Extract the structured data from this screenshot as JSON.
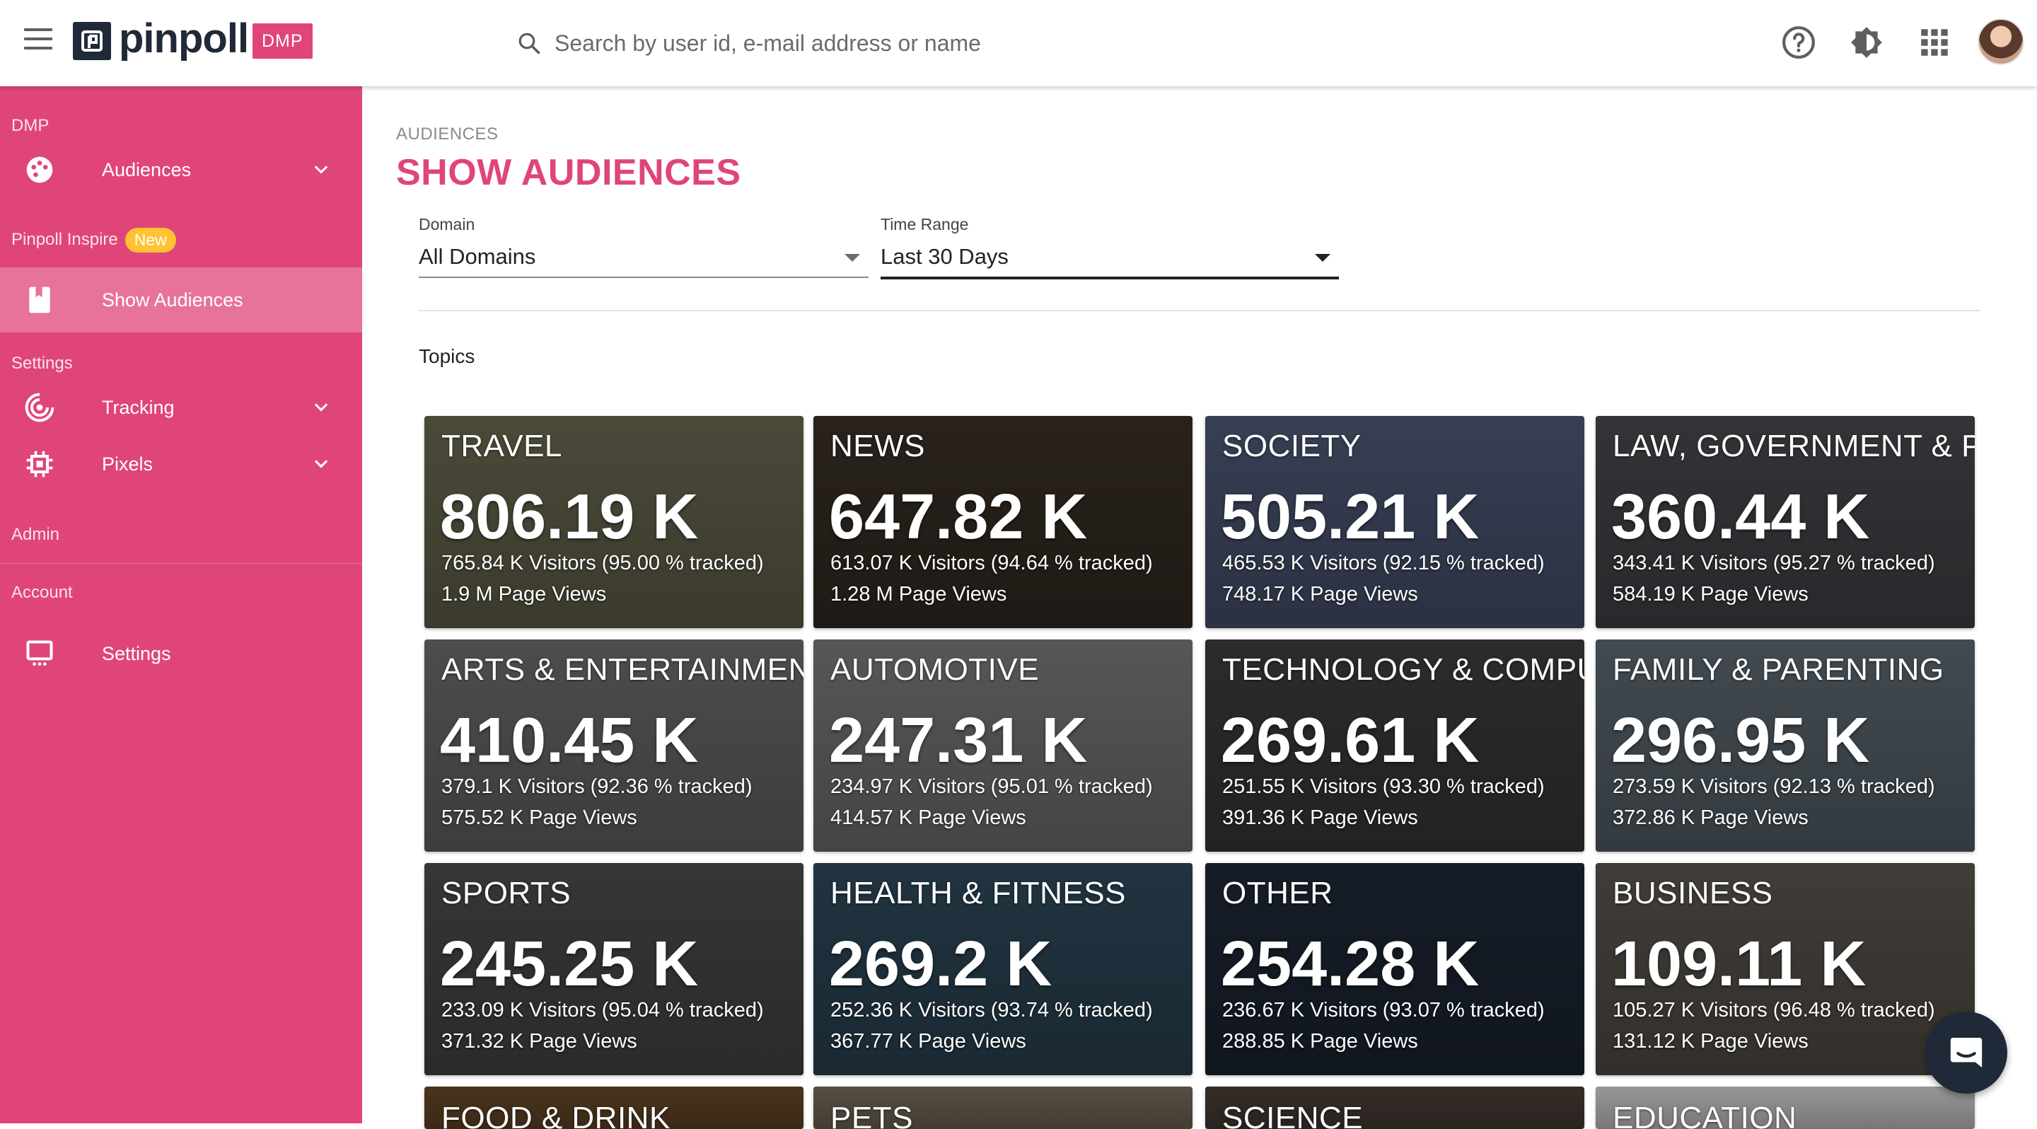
{
  "app": {
    "brand": "pinpoll",
    "badge": "DMP",
    "logo_mark": "p"
  },
  "search": {
    "placeholder": "Search by user id, e-mail address or name",
    "icon": "search-icon"
  },
  "top_icons": [
    "help-icon",
    "theme-toggle-icon",
    "apps-grid-icon",
    "avatar"
  ],
  "sidebar": {
    "section_dmp": "DMP",
    "audiences": "Audiences",
    "inspire_label": "Pinpoll Inspire",
    "new_badge": "New",
    "show_audiences": "Show Audiences",
    "section_settings": "Settings",
    "tracking": "Tracking",
    "pixels": "Pixels",
    "section_admin": "Admin",
    "section_account": "Account",
    "settings": "Settings"
  },
  "page": {
    "breadcrumb": "AUDIENCES",
    "title": "SHOW AUDIENCES",
    "topics_label": "Topics"
  },
  "filters": {
    "domain_label": "Domain",
    "domain_value": "All Domains",
    "time_label": "Time Range",
    "time_value": "Last 30 Days"
  },
  "tiles": [
    {
      "title": "TRAVEL",
      "count": "806.19 K",
      "visitors": "765.84 K Visitors (95.00 % tracked)",
      "views": "1.9 M Page Views",
      "color": "#6b6a52"
    },
    {
      "title": "NEWS",
      "count": "647.82 K",
      "visitors": "613.07 K Visitors (94.64 % tracked)",
      "views": "1.28 M Page Views",
      "color": "#3a3028"
    },
    {
      "title": "SOCIETY",
      "count": "505.21 K",
      "visitors": "465.53 K Visitors (92.15 % tracked)",
      "views": "748.17 K Page Views",
      "color": "#4f5a78"
    },
    {
      "title": "LAW, GOVERNMENT & PO",
      "count": "360.44 K",
      "visitors": "343.41 K Visitors (95.27 % tracked)",
      "views": "584.19 K Page Views",
      "color": "#474a4e"
    },
    {
      "title": "ARTS & ENTERTAINMENT",
      "count": "410.45 K",
      "visitors": "379.1 K Visitors (92.36 % tracked)",
      "views": "575.52 K Page Views",
      "color": "#6e6e6e"
    },
    {
      "title": "AUTOMOTIVE",
      "count": "247.31 K",
      "visitors": "234.97 K Visitors (95.01 % tracked)",
      "views": "414.57 K Page Views",
      "color": "#7c7c7a"
    },
    {
      "title": "TECHNOLOGY & COMPUT",
      "count": "269.61 K",
      "visitors": "251.55 K Visitors (93.30 % tracked)",
      "views": "391.36 K Page Views",
      "color": "#3e3e40"
    },
    {
      "title": "FAMILY & PARENTING",
      "count": "296.95 K",
      "visitors": "273.59 K Visitors (92.13 % tracked)",
      "views": "372.86 K Page Views",
      "color": "#5e6a73"
    },
    {
      "title": "SPORTS",
      "count": "245.25 K",
      "visitors": "233.09 K Visitors (95.04 % tracked)",
      "views": "371.32 K Page Views",
      "color": "#4d4d4d"
    },
    {
      "title": "HEALTH & FITNESS",
      "count": "269.2 K",
      "visitors": "252.36 K Visitors (93.74 % tracked)",
      "views": "367.77 K Page Views",
      "color": "#2f4a5c"
    },
    {
      "title": "OTHER",
      "count": "254.28 K",
      "visitors": "236.67 K Visitors (93.07 % tracked)",
      "views": "288.85 K Page Views",
      "color": "#1f2937"
    },
    {
      "title": "BUSINESS",
      "count": "109.11 K",
      "visitors": "105.27 K Visitors (96.48 % tracked)",
      "views": "131.12 K Page Views",
      "color": "#5c5750"
    },
    {
      "title": "FOOD & DRINK",
      "color": "#6b4a2a"
    },
    {
      "title": "PETS",
      "color": "#7a6f60"
    },
    {
      "title": "SCIENCE",
      "color": "#4b4039"
    },
    {
      "title": "EDUCATION",
      "color": "#d8d8d8"
    }
  ]
}
